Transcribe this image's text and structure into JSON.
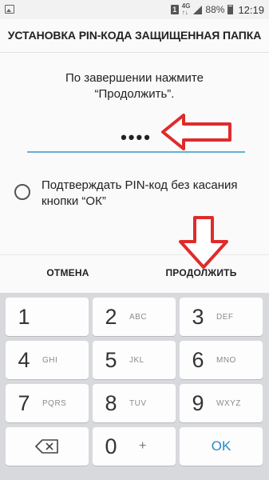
{
  "status": {
    "sim": "1",
    "net_top": "4G",
    "net_bot": "↑↓",
    "battery": "88%",
    "time": "12:19"
  },
  "dialog": {
    "title": "УСТАНОВКА PIN-КОДА ЗАЩИЩЕННАЯ ПАПКА",
    "instruction_line1": "По завершении нажмите",
    "instruction_line2": "“Продолжить”.",
    "pin_value": "••••",
    "radio_label": "Подтверждать PIN-код без касания кнопки “ОК”",
    "cancel_label": "ОТМЕНА",
    "continue_label": "ПРОДОЛЖИТЬ"
  },
  "keyboard": {
    "rows": [
      [
        {
          "num": "1",
          "letters": ""
        },
        {
          "num": "2",
          "letters": "ABC"
        },
        {
          "num": "3",
          "letters": "DEF"
        }
      ],
      [
        {
          "num": "4",
          "letters": "GHI"
        },
        {
          "num": "5",
          "letters": "JKL"
        },
        {
          "num": "6",
          "letters": "MNO"
        }
      ],
      [
        {
          "num": "7",
          "letters": "PQRS"
        },
        {
          "num": "8",
          "letters": "TUV"
        },
        {
          "num": "9",
          "letters": "WXYZ"
        }
      ]
    ],
    "zero": "0",
    "plus": "+",
    "ok": "OK"
  },
  "colors": {
    "accent": "#5fb3d9",
    "arrow": "#e02b2b"
  }
}
